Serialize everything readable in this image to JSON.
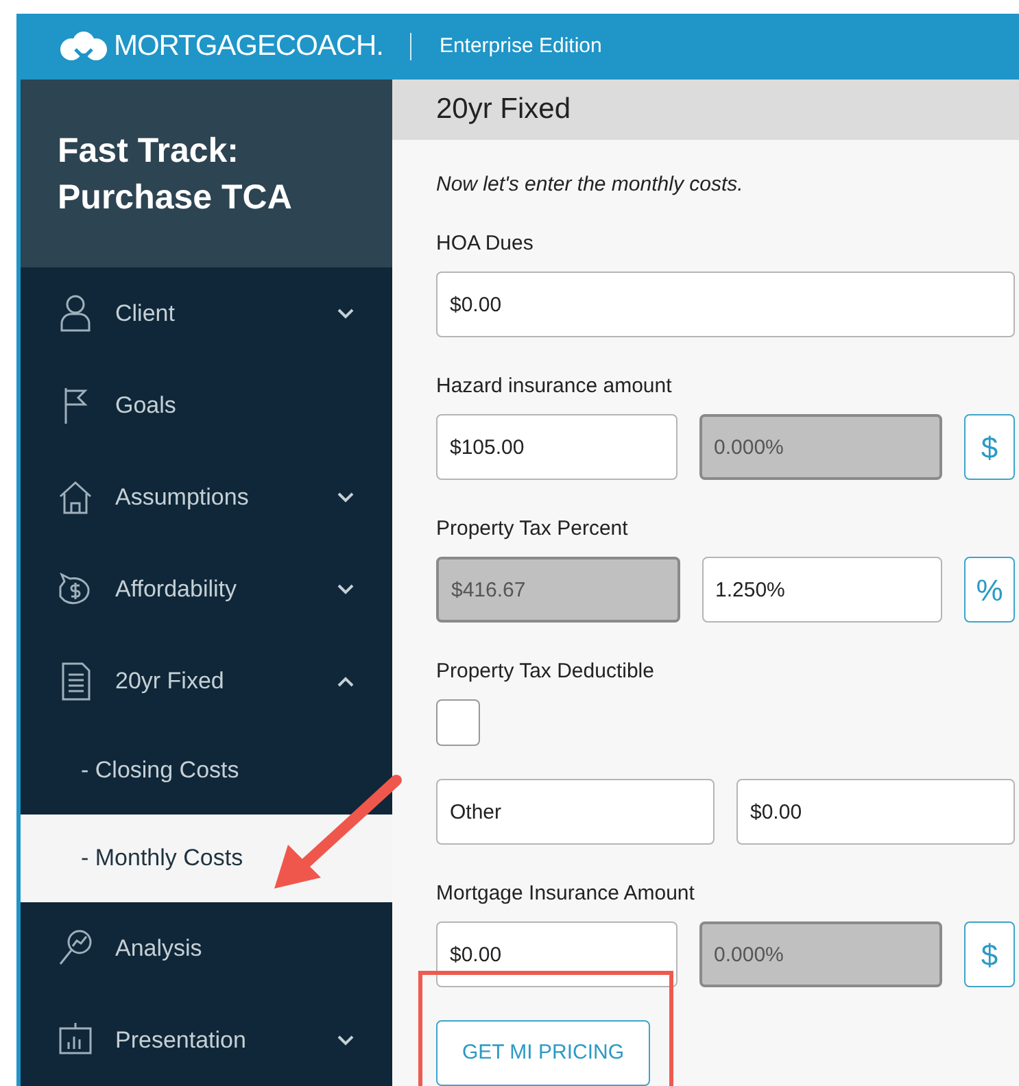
{
  "topbar": {
    "brand": "MORTGAGECOACH.",
    "edition": "Enterprise Edition"
  },
  "sidebar": {
    "title": "Fast Track: Purchase TCA",
    "items": [
      {
        "label": "Client",
        "kind": "group",
        "expanded": false,
        "selected": false
      },
      {
        "label": "Goals",
        "kind": "link",
        "selected": false
      },
      {
        "label": "Assumptions",
        "kind": "group",
        "expanded": false,
        "selected": false
      },
      {
        "label": "Affordability",
        "kind": "group",
        "expanded": false,
        "selected": false
      },
      {
        "label": "20yr Fixed",
        "kind": "group",
        "expanded": true,
        "selected": false,
        "children": [
          {
            "label": "- Closing Costs",
            "selected": false
          },
          {
            "label": "- Monthly Costs",
            "selected": true
          }
        ]
      },
      {
        "label": "Analysis",
        "kind": "link",
        "selected": false
      },
      {
        "label": "Presentation",
        "kind": "group",
        "expanded": false,
        "selected": false
      }
    ]
  },
  "main": {
    "title": "20yr Fixed",
    "rows": [
      {
        "kind": "note",
        "text": "Now let's enter the monthly costs."
      },
      {
        "kind": "label",
        "text": "HOA Dues"
      },
      {
        "kind": "fields",
        "fields": [
          {
            "value": "$0.00",
            "disabled": false
          }
        ]
      },
      {
        "kind": "label",
        "text": "Hazard insurance amount"
      },
      {
        "kind": "fields",
        "fields": [
          {
            "value": "$105.00",
            "disabled": false
          },
          {
            "value": "0.000%",
            "disabled": true
          }
        ],
        "toggle": "$"
      },
      {
        "kind": "label",
        "text": "Property Tax Percent"
      },
      {
        "kind": "fields",
        "fields": [
          {
            "value": "$416.67",
            "disabled": true
          },
          {
            "value": "1.250%",
            "disabled": false
          }
        ],
        "toggle": "%"
      },
      {
        "kind": "label",
        "text": "Property Tax Deductible"
      },
      {
        "kind": "checkbox",
        "checked": false
      },
      {
        "kind": "fields",
        "fields": [
          {
            "value": "Other",
            "disabled": false
          },
          {
            "value": "$0.00",
            "disabled": false
          }
        ]
      },
      {
        "kind": "label",
        "text": "Mortgage Insurance Amount"
      },
      {
        "kind": "fields",
        "fields": [
          {
            "value": "$0.00",
            "disabled": false
          },
          {
            "value": "0.000%",
            "disabled": true
          }
        ],
        "toggle": "$"
      },
      {
        "kind": "button",
        "label": "GET MI PRICING"
      }
    ]
  }
}
